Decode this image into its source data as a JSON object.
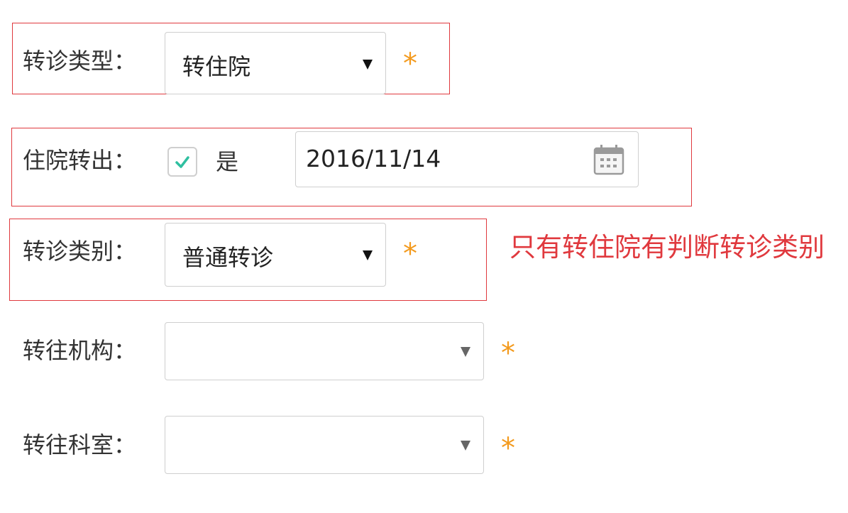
{
  "form": {
    "transfer_type": {
      "label": "转诊类型：",
      "value": "转住院",
      "required_mark": "*"
    },
    "inpatient_transfer": {
      "label": "住院转出：",
      "checked": true,
      "check_label": "是",
      "date_value": "2016/11/14",
      "date_icon": "calendar-icon"
    },
    "transfer_category": {
      "label": "转诊类别：",
      "value": "普通转诊",
      "required_mark": "*"
    },
    "target_institution": {
      "label": "转往机构：",
      "value": "",
      "required_mark": "*"
    },
    "target_department": {
      "label": "转往科室：",
      "value": "",
      "required_mark": "*"
    }
  },
  "annotation": {
    "note": "只有转住院有判断转诊类别"
  },
  "colors": {
    "highlight_border": "#e0393e",
    "required_mark": "#f39a1d",
    "note_text": "#e0393e",
    "checkmark": "#2fbfa0"
  }
}
